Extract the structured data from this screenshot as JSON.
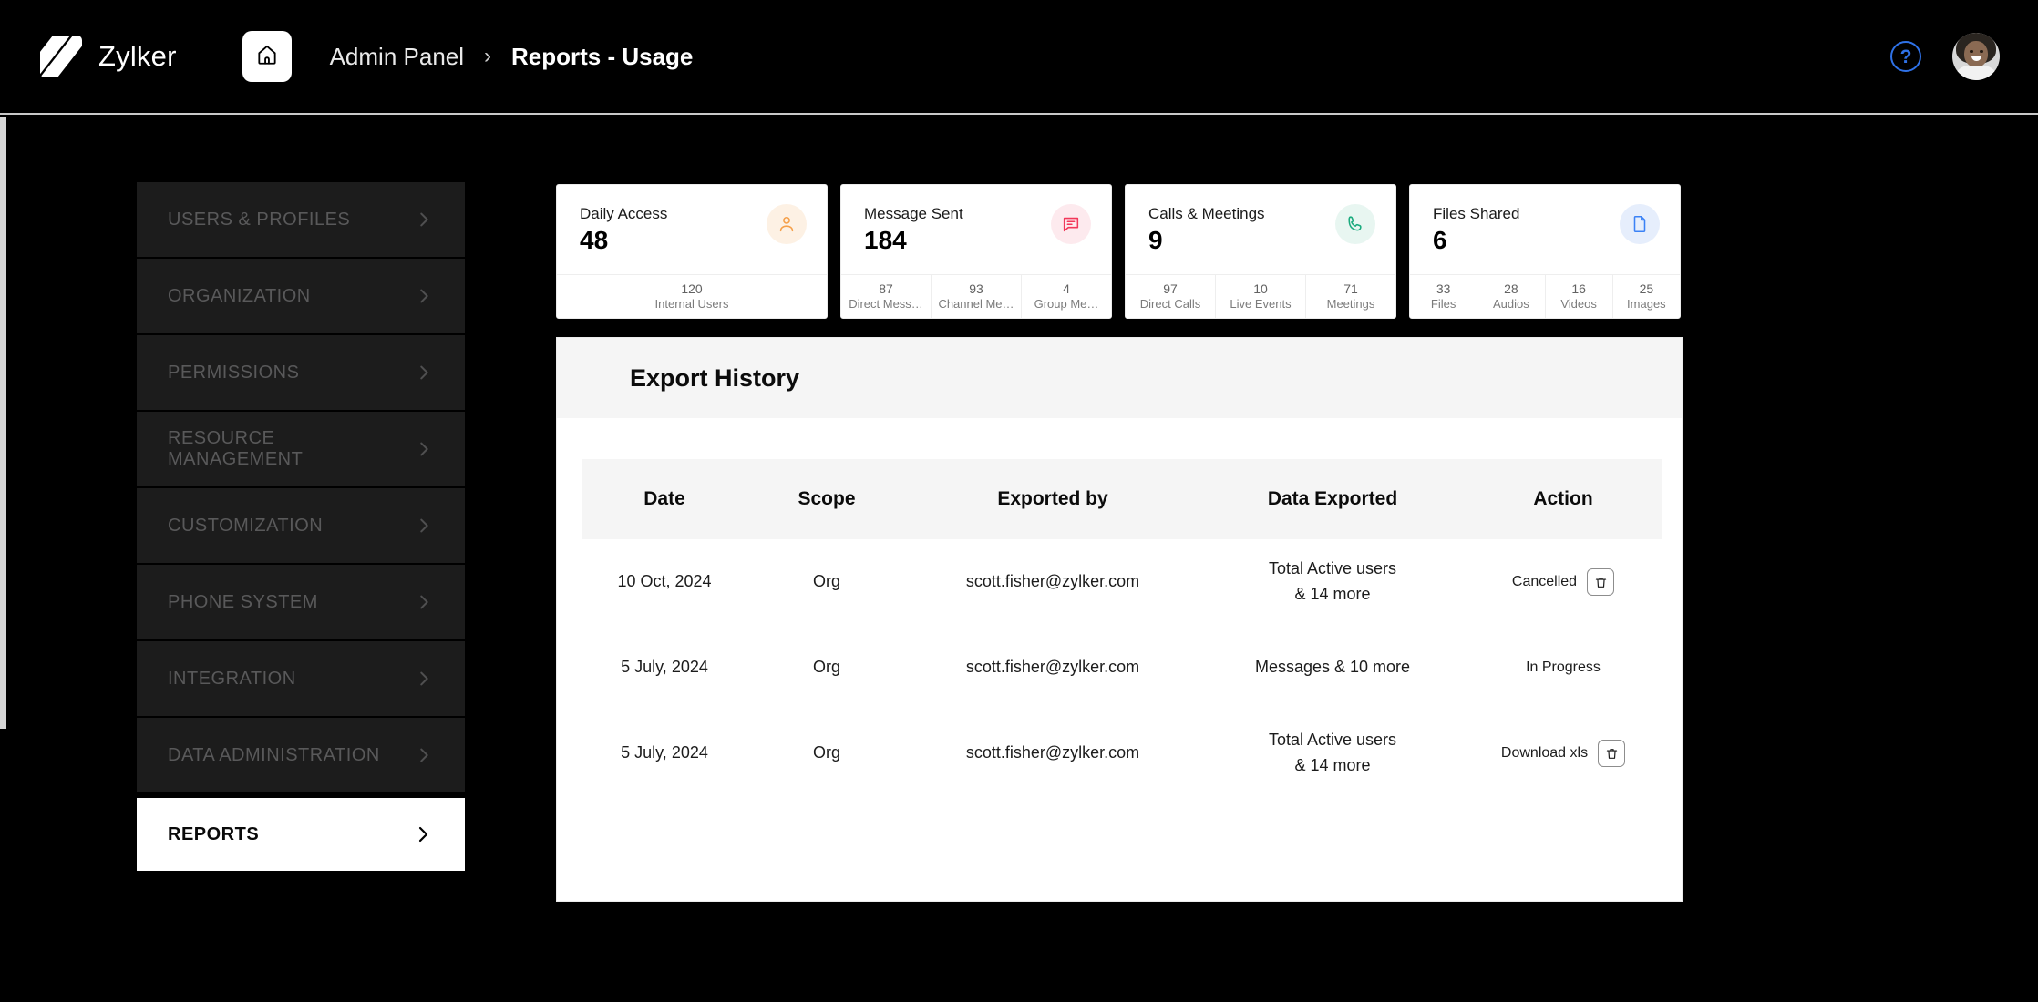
{
  "header": {
    "brand": "Zylker",
    "logo_icon": "zylker-logo",
    "home_icon": "home-icon",
    "breadcrumb": [
      "Admin Panel",
      "Reports - Usage"
    ],
    "breadcrumb_separator": "›",
    "help_icon": "?",
    "avatar_icon": "user-avatar",
    "accent_blue": "#2f72e8"
  },
  "sidebar": {
    "items": [
      {
        "label": "USERS & PROFILES",
        "active": false
      },
      {
        "label": "ORGANIZATION",
        "active": false
      },
      {
        "label": "PERMISSIONS",
        "active": false
      },
      {
        "label": "RESOURCE MANAGEMENT",
        "active": false
      },
      {
        "label": "CUSTOMIZATION",
        "active": false
      },
      {
        "label": "PHONE SYSTEM",
        "active": false
      },
      {
        "label": "INTEGRATION",
        "active": false
      },
      {
        "label": "DATA ADMINISTRATION",
        "active": false
      },
      {
        "label": "REPORTS",
        "active": true
      }
    ],
    "chevron_icon": "chevron-right-icon"
  },
  "stats": [
    {
      "title": "Daily Access",
      "value": "48",
      "icon": "user-icon",
      "icon_color": "#f5a04a",
      "icon_bg": "#fdf1e4",
      "footer": [
        {
          "num": "120",
          "label": "Internal Users"
        }
      ]
    },
    {
      "title": "Message Sent",
      "value": "184",
      "icon": "message-icon",
      "icon_color": "#f2385a",
      "icon_bg": "#fdeaee",
      "footer": [
        {
          "num": "87",
          "label": "Direct Mess…"
        },
        {
          "num": "93",
          "label": "Channel Me…"
        },
        {
          "num": "4",
          "label": "Group Me…"
        }
      ]
    },
    {
      "title": "Calls & Meetings",
      "value": "9",
      "icon": "phone-icon",
      "icon_color": "#1bab7e",
      "icon_bg": "#e8f6f1",
      "footer": [
        {
          "num": "97",
          "label": "Direct Calls"
        },
        {
          "num": "10",
          "label": "Live Events"
        },
        {
          "num": "71",
          "label": "Meetings"
        }
      ]
    },
    {
      "title": "Files Shared",
      "value": "6",
      "icon": "file-icon",
      "icon_color": "#3b82f6",
      "icon_bg": "#e6eefc",
      "footer": [
        {
          "num": "33",
          "label": "Files"
        },
        {
          "num": "28",
          "label": "Audios"
        },
        {
          "num": "16",
          "label": "Videos"
        },
        {
          "num": "25",
          "label": "Images"
        }
      ]
    }
  ],
  "panel": {
    "title": "Export History",
    "columns": [
      "Date",
      "Scope",
      "Exported by",
      "Data Exported",
      "Action"
    ],
    "rows": [
      {
        "date": "10 Oct, 2024",
        "scope": "Org",
        "exported_by": "scott.fisher@zylker.com",
        "data_exported": "Total Active users\n& 14 more",
        "action_label": "Cancelled",
        "has_delete": true
      },
      {
        "date": "5 July, 2024",
        "scope": "Org",
        "exported_by": "scott.fisher@zylker.com",
        "data_exported": "Messages & 10 more",
        "action_label": "In Progress",
        "has_delete": false
      },
      {
        "date": "5 July, 2024",
        "scope": "Org",
        "exported_by": "scott.fisher@zylker.com",
        "data_exported": "Total Active users\n& 14 more",
        "action_label": "Download xls",
        "has_delete": true
      }
    ],
    "delete_icon": "trash-icon"
  }
}
